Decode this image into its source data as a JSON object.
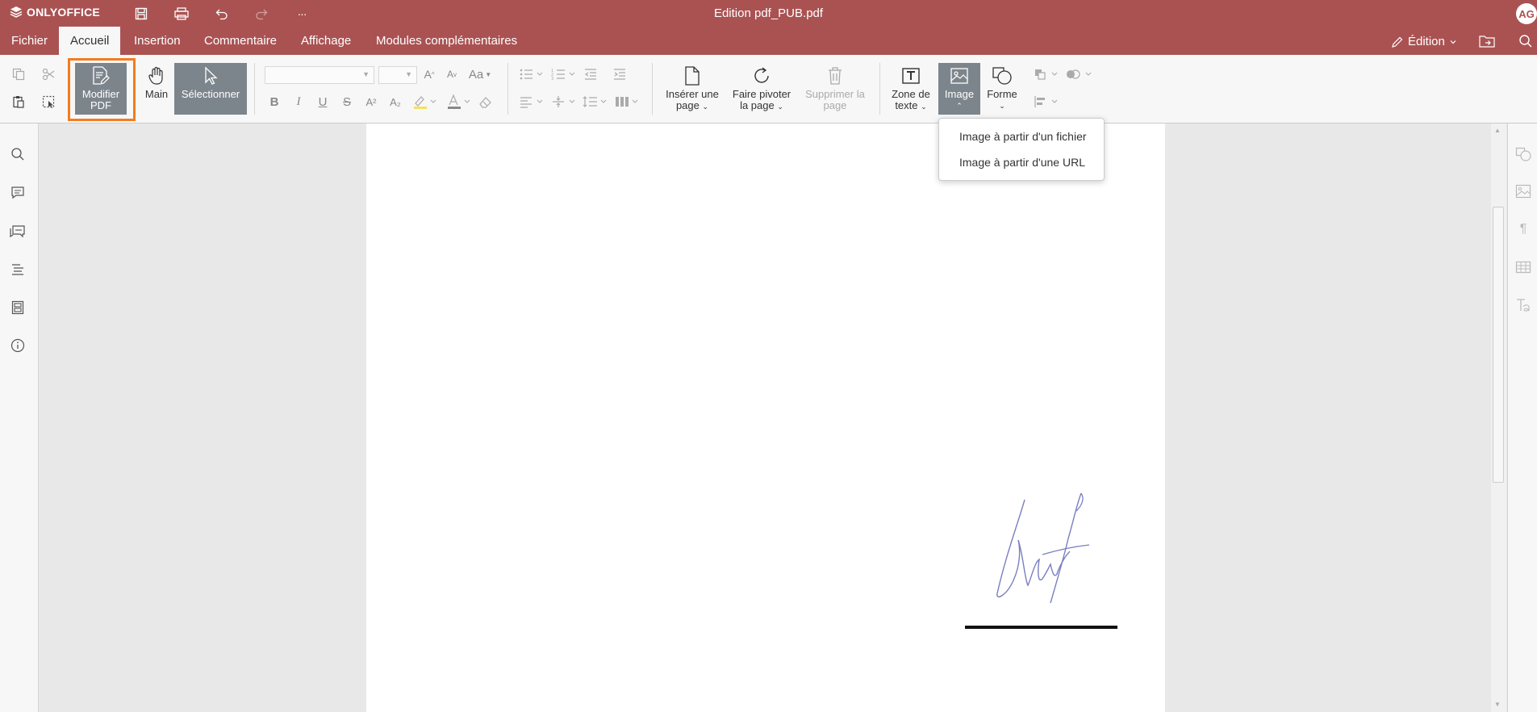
{
  "titlebar": {
    "brand": "ONLYOFFICE",
    "doc_title": "Edition pdf_PUB.pdf",
    "avatar_initials": "AG",
    "more_label": "···"
  },
  "menu": {
    "tabs": [
      "Fichier",
      "Accueil",
      "Insertion",
      "Commentaire",
      "Affichage",
      "Modules complémentaires"
    ],
    "active_tab": "Accueil",
    "mode_label": "Édition"
  },
  "toolbar": {
    "modifier_pdf": [
      "Modifier",
      "PDF"
    ],
    "main": "Main",
    "selectionner": "Sélectionner",
    "inserer_page": [
      "Insérer une",
      "page"
    ],
    "faire_pivoter": [
      "Faire pivoter",
      "la page"
    ],
    "supprimer_page": [
      "Supprimer la",
      "page"
    ],
    "zone_texte": [
      "Zone de",
      "texte"
    ],
    "image": "Image",
    "forme": "Forme",
    "bold": "B",
    "italic": "I",
    "underline": "U",
    "strike": "S",
    "superscript": "A²",
    "subscript": "A₂",
    "font_size_up": "A",
    "font_size_down": "A",
    "change_case": "Aa"
  },
  "image_menu": {
    "items": [
      "Image à partir d'un fichier",
      "Image à partir d'une URL"
    ]
  },
  "colors": {
    "header_bg": "#aa5252",
    "toolbar_bg": "#f7f7f7",
    "selected_btn": "#7d858c",
    "highlight_box": "#f47c20"
  }
}
